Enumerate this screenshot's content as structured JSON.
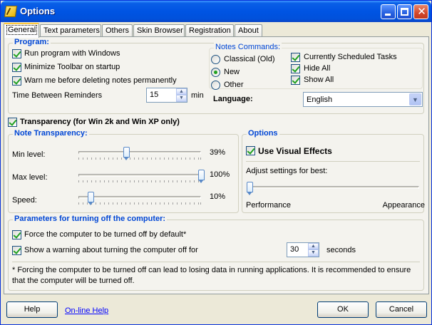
{
  "window": {
    "title": "Options"
  },
  "tabs": [
    "General",
    "Text parameters",
    "Others",
    "Skin Browser",
    "Registration",
    "About"
  ],
  "program": {
    "title": "Program:",
    "run_with_windows": {
      "label": "Run program with Windows",
      "checked": true
    },
    "minimize_toolbar": {
      "label": "Minimize Toolbar on startup",
      "checked": true
    },
    "warn_before_delete": {
      "label": "Warn me before deleting notes permanently",
      "checked": true
    },
    "reminders_label": "Time Between Reminders",
    "reminders_value": "15",
    "reminders_unit": "min"
  },
  "notes_commands": {
    "title": "Notes Commands:",
    "options": [
      "Classical (Old)",
      "New",
      "Other"
    ],
    "selected": "New",
    "scheduled_tasks": {
      "label": "Currently Scheduled Tasks",
      "checked": true
    },
    "hide_all": {
      "label": "Hide All",
      "checked": true
    },
    "show_all": {
      "label": "Show All",
      "checked": true
    }
  },
  "language": {
    "label": "Language:",
    "value": "English"
  },
  "transparency": {
    "label": "Transparency (for Win 2k and Win XP only)",
    "checked": true
  },
  "note_transparency": {
    "title": "Note Transparency:",
    "min": {
      "label": "Min level:",
      "value": "39%",
      "fraction": 0.39
    },
    "max": {
      "label": "Max level:",
      "value": "100%",
      "fraction": 1.0
    },
    "speed": {
      "label": "Speed:",
      "value": "10%",
      "fraction": 0.1
    }
  },
  "options": {
    "title": "Options",
    "visual_effects": {
      "label": "Use Visual Effects",
      "checked": true
    },
    "adjust_label": "Adjust settings for best:",
    "slider_fraction": 0.0,
    "left_label": "Performance",
    "right_label": "Appearance"
  },
  "shutdown": {
    "title": "Parameters for turning off the computer:",
    "force": {
      "label": "Force the computer to be turned off by default*",
      "checked": true
    },
    "warning": {
      "label": "Show a warning about turning the computer off for",
      "checked": true
    },
    "seconds_value": "30",
    "seconds_unit": "seconds",
    "footnote": "* Forcing the computer to be turned off can lead to losing data in running applications. It is recommended to ensure that the computer will be turned off."
  },
  "buttons": {
    "help": "Help",
    "online_help": "On-line Help",
    "ok": "OK",
    "cancel": "Cancel"
  }
}
